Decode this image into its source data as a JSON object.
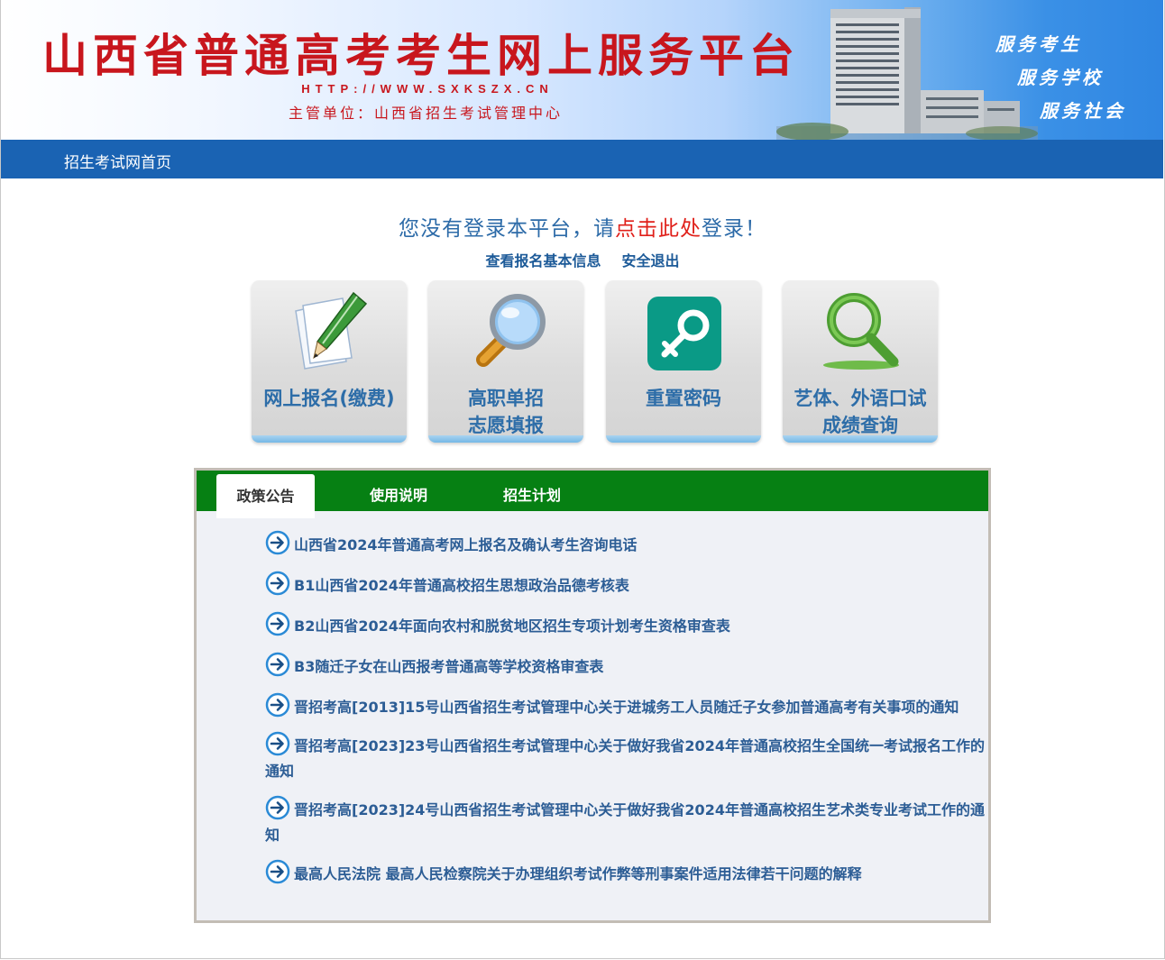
{
  "banner": {
    "title": "山西省普通高考考生网上服务平台",
    "url": "HTTP://WWW.SXKSZX.CN",
    "host_org": "主管单位：山西省招生考试管理中心",
    "slogans": [
      "服务考生",
      "服务学校",
      "服务社会"
    ]
  },
  "nav": {
    "home_label": "招生考试网首页"
  },
  "login": {
    "prefix": "您没有登录本平台，请",
    "link": "点击此处",
    "suffix": "登录！",
    "view_info": "查看报名基本信息",
    "logout": "安全退出"
  },
  "tiles": [
    {
      "line1": "网上报名(缴费)",
      "line2": "",
      "icon": "pencil-paper-icon"
    },
    {
      "line1": "高职单招",
      "line2": "志愿填报",
      "icon": "magnifier-icon"
    },
    {
      "line1": "重置密码",
      "line2": "",
      "icon": "key-icon"
    },
    {
      "line1": "艺体、外语口试",
      "line2": "成绩查询",
      "icon": "search-icon"
    }
  ],
  "tabs": [
    {
      "label": "政策公告",
      "active": true
    },
    {
      "label": "使用说明",
      "active": false
    },
    {
      "label": "招生计划",
      "active": false
    }
  ],
  "news": [
    "山西省2024年普通高考网上报名及确认考生咨询电话",
    "B1山西省2024年普通高校招生思想政治品德考核表",
    "B2山西省2024年面向农村和脱贫地区招生专项计划考生资格审查表",
    "B3随迁子女在山西报考普通高等学校资格审查表",
    "晋招考高[2013]15号山西省招生考试管理中心关于进城务工人员随迁子女参加普通高考有关事项的通知",
    "晋招考高[2023]23号山西省招生考试管理中心关于做好我省2024年普通高校招生全国统一考试报名工作的通知",
    "晋招考高[2023]24号山西省招生考试管理中心关于做好我省2024年普通高校招生艺术类专业考试工作的通知",
    "最高人民法院 最高人民检察院关于办理组织考试作弊等刑事案件适用法律若干问题的解释"
  ],
  "colors": {
    "title_red": "#c8161d",
    "nav_blue": "#1a63b3",
    "tab_green": "#068013",
    "link_blue": "#2c5d95"
  }
}
